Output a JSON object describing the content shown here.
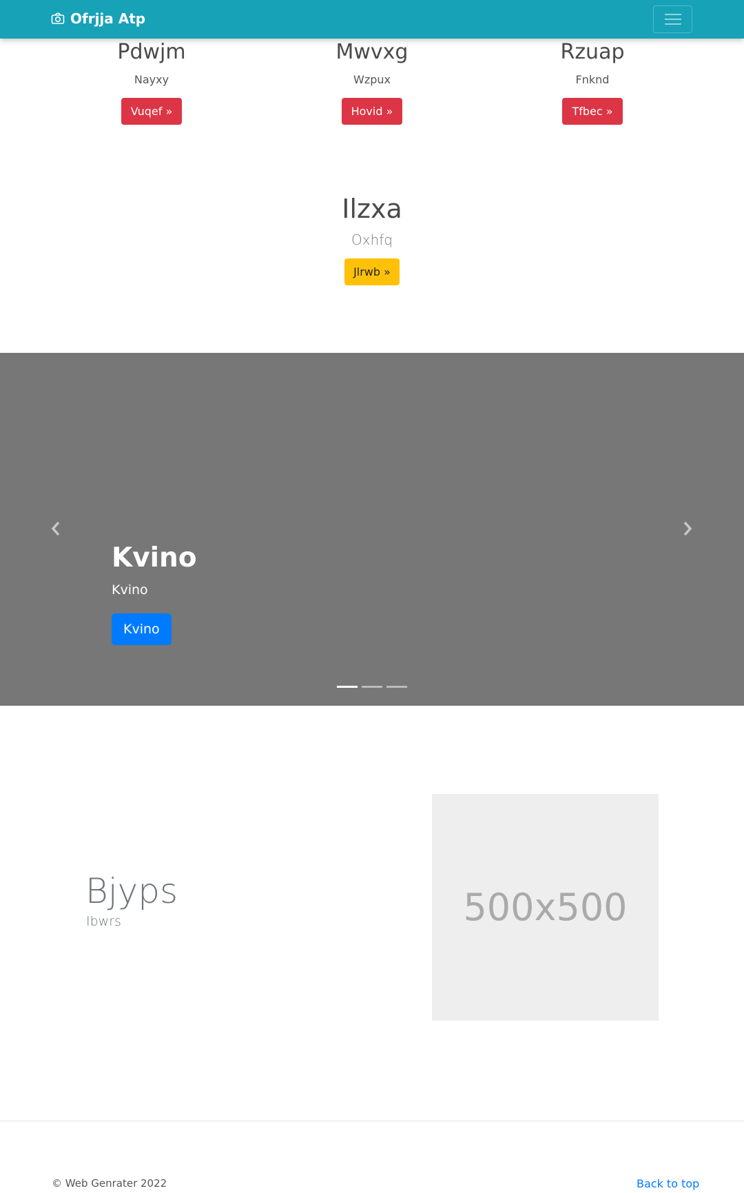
{
  "navbar": {
    "brand": "Ofrjja Atp",
    "brand_icon": "camera-icon",
    "toggler_icon": "hamburger-icon",
    "background": "#17a2b8"
  },
  "columns": [
    {
      "title": "Pdwjm",
      "text": "Nayxy",
      "button": "Vuqef »"
    },
    {
      "title": "Mwvxg",
      "text": "Wzpux",
      "button": "Hovid »"
    },
    {
      "title": "Rzuap",
      "text": "Fnknd",
      "button": "Tfbec »"
    }
  ],
  "center_block": {
    "title": "Ilzxa",
    "text": "Oxhfq",
    "button": "Jlrwb »"
  },
  "carousel": {
    "title": "Kvino",
    "text": "Kvino",
    "button": "Kvino",
    "prev_icon": "chevron-left-icon",
    "next_icon": "chevron-right-icon",
    "slides": 3,
    "active_slide": 1
  },
  "featurette": {
    "heading": "Bjyps",
    "lead": "Ibwrs",
    "image_label": "500x500"
  },
  "footer": {
    "copyright": "© Web Genrater 2022",
    "back_to_top": "Back to top"
  },
  "colors": {
    "danger": "#dc3545",
    "warning": "#ffc107",
    "primary": "#007bff",
    "carousel_bg": "#777777"
  }
}
